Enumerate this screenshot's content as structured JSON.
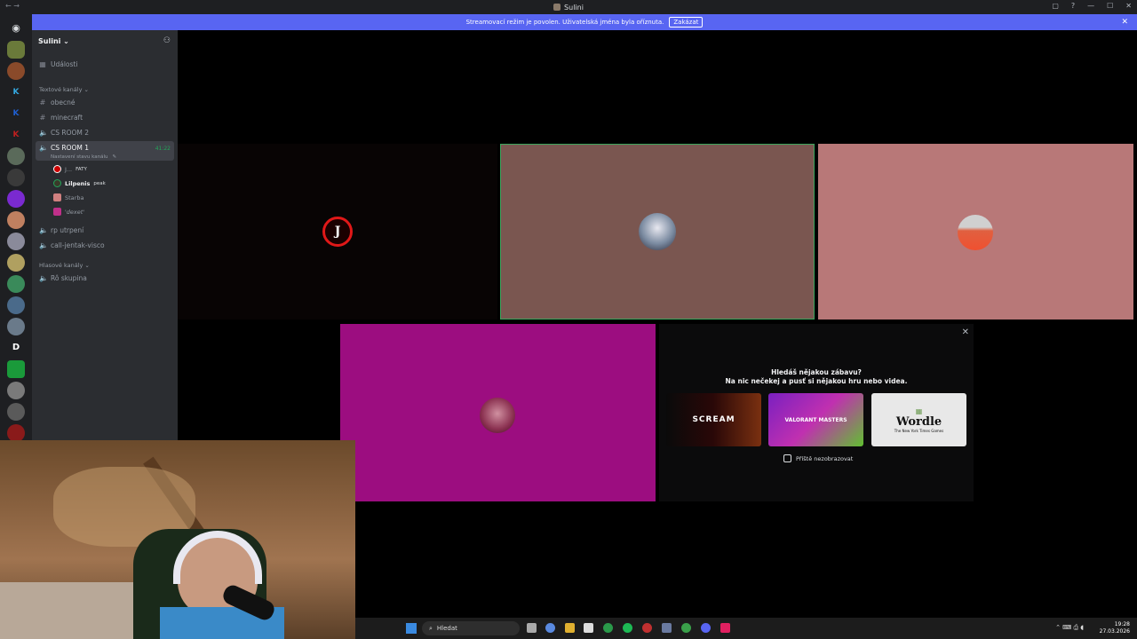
{
  "window": {
    "title": "Sulini",
    "controls": [
      "▢",
      "?",
      "—",
      "☐",
      "✕"
    ]
  },
  "banner": {
    "text": "Streamovací režim je povolen. Uživatelská jména byla oříznuta.",
    "button": "Zakázat",
    "close": "✕"
  },
  "server": {
    "name": "Sulini"
  },
  "sidebar": {
    "events": "Události",
    "text_category": "Textové kanály",
    "text_channels": [
      "obecné",
      "minecraft"
    ],
    "voice_channels_top": [
      "CS ROOM 2"
    ],
    "active_channel": {
      "name": "CS ROOM 1",
      "status": "Nastavení stavu kanálu",
      "timer": "41:22"
    },
    "members": [
      {
        "name": "J...",
        "tag": "FATY"
      },
      {
        "name": "Lilpenis",
        "tag": "peak"
      },
      {
        "name": "Starba",
        "tag": ""
      },
      {
        "name": "'dexet'",
        "tag": ""
      }
    ],
    "voice_channels_more": [
      "rp utrpení",
      "call-jentak-visco"
    ],
    "voice_category": "Hlasové kanály",
    "voice_channels_bottom": [
      "Rô skupina"
    ]
  },
  "promo": {
    "question": "Hledáš nějakou zábavu?",
    "subtext": "Na nic nečekej a pusť si nějakou hru nebo videa.",
    "cards": [
      "SCREAM",
      "VALORANT MASTERS",
      "Wordle"
    ],
    "wordle_sub": "The New York Times Games",
    "dont_show": "Příště nezobrazovat",
    "close": "✕"
  },
  "taskbar": {
    "search": "Hledat",
    "time": "19:28",
    "date": "27.03.2026"
  },
  "colors": {
    "accent": "#5865f2",
    "speaking": "#23a55a",
    "tile2": "#7a5650",
    "tile3": "#b87878",
    "tile4": "#9c0d80"
  }
}
